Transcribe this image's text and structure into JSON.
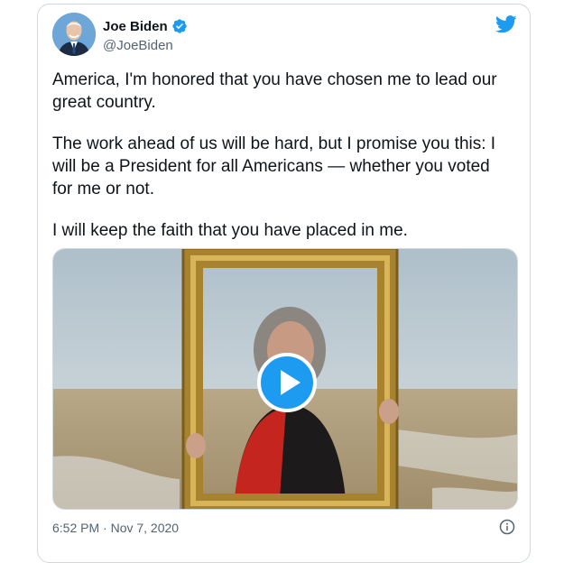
{
  "author": {
    "display_name": "Joe Biden",
    "handle": "@JoeBiden",
    "verified": true,
    "avatar_icon": "profile-photo"
  },
  "brand": {
    "icon": "twitter-bird-icon",
    "color": "#1d9bf0"
  },
  "tweet": {
    "paragraphs": [
      "America, I'm honored that you have chosen me to lead our great country.",
      "The work ahead of us will be hard, but I promise you this: I will be a President for all Americans — whether you voted for me or not.",
      "I will keep the faith that you have placed in me."
    ],
    "timestamp": "6:52 PM · Nov 7, 2020"
  },
  "media": {
    "type": "video",
    "play_icon": "play-icon"
  },
  "colors": {
    "text": "#0f1419",
    "secondary_text": "#536471",
    "border": "#cfd9de",
    "accent": "#1d9bf0"
  }
}
